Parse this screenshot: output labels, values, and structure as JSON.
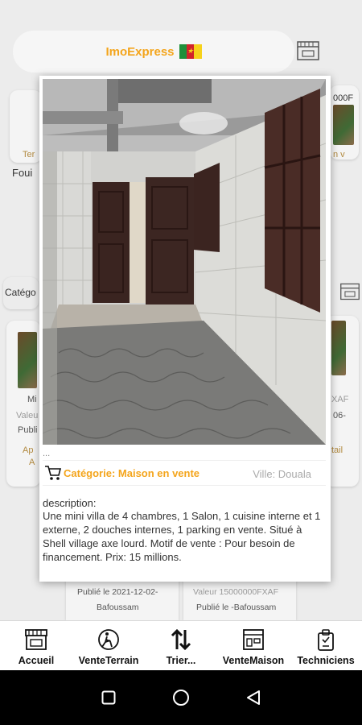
{
  "header": {
    "brand": "ImoExpress"
  },
  "background": {
    "left_label": "Foui",
    "left_badge": "Ter",
    "right_price": "000F",
    "right_tag": "n v",
    "category_label": "Catégo",
    "card_left_lines": [
      "Mi",
      "Valeu",
      "Publi",
      "Ap",
      "A"
    ],
    "card_right_lines": [
      "XAF",
      "06-",
      "tail"
    ],
    "bottom_left": {
      "published": "Publié le 2021-12-02-",
      "city": "Bafoussam"
    },
    "bottom_right": {
      "value": "Valeur 15000000FXAF",
      "published": "Publié le -Bafoussam"
    }
  },
  "popup": {
    "ellipsis": "...",
    "category": "Catégorie: Maison en vente",
    "city": "Ville: Douala",
    "description_label": "description:",
    "description": "Une mini villa de 4 chambres, 1 Salon, 1 cuisine interne et 1 externe, 2 douches internes, 1 parking en vente. Situé à Shell village axe lourd. Motif de vente : Pour besoin de financement. Prix: 15 millions."
  },
  "nav": {
    "items": [
      {
        "label": "Accueil",
        "icon": "shop-icon"
      },
      {
        "label": "VenteTerrain",
        "icon": "land-icon"
      },
      {
        "label": "Trier...",
        "icon": "sort-icon"
      },
      {
        "label": "VenteMaison",
        "icon": "house-sale-icon"
      },
      {
        "label": "Techniciens",
        "icon": "technician-icon"
      }
    ]
  },
  "colors": {
    "accent": "#f4a51c",
    "text": "#333333"
  }
}
